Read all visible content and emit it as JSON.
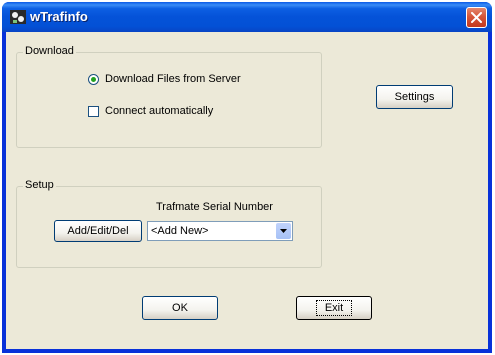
{
  "window": {
    "title": "wTrafinfo",
    "icon": "app-icon",
    "close_icon": "close-icon"
  },
  "download": {
    "group_label": "Download",
    "radio_label": "Download Files from Server",
    "radio_checked": true,
    "checkbox_label": "Connect automatically",
    "checkbox_checked": false
  },
  "settings_button": "Settings",
  "setup": {
    "group_label": "Setup",
    "serial_label": "Trafmate Serial Number",
    "add_edit_button": "Add/Edit/Del",
    "combo_value": "<Add New>"
  },
  "footer": {
    "ok_button": "OK",
    "exit_button": "Exit"
  },
  "colors": {
    "title_bar": "#0552d8",
    "client_bg": "#ece9d8",
    "close_button": "#d7573a",
    "radio_dot": "#21a121"
  }
}
